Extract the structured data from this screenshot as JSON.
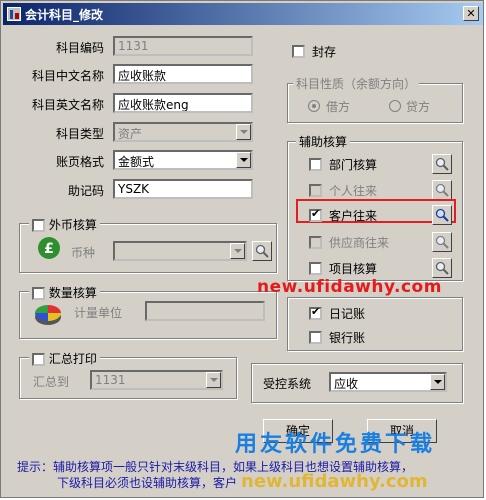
{
  "window": {
    "title": "会计科目_修改"
  },
  "fields": {
    "code_label": "科目编码",
    "code_value": "1131",
    "cn_name_label": "科目中文名称",
    "cn_name_value": "应收账款",
    "en_name_label": "科目英文名称",
    "en_name_value": "应收账款eng",
    "type_label": "科目类型",
    "type_value": "资产",
    "format_label": "账页格式",
    "format_value": "金额式",
    "mnemonic_label": "助记码",
    "mnemonic_value": "YSZK"
  },
  "foreign": {
    "title": "外币核算",
    "currency_label": "币种",
    "currency_value": ""
  },
  "quantity": {
    "title": "数量核算",
    "unit_label": "计量单位",
    "unit_value": ""
  },
  "summary": {
    "title": "汇总打印",
    "to_label": "汇总到",
    "to_value": "1131"
  },
  "seal": {
    "label": "封存",
    "checked": false
  },
  "nature": {
    "title": "科目性质（余额方向）",
    "debit": "借方",
    "credit": "贷方",
    "selected": "debit"
  },
  "aux": {
    "title": "辅助核算",
    "items": [
      {
        "label": "部门核算",
        "checked": false,
        "enabled": true
      },
      {
        "label": "个人往来",
        "checked": false,
        "enabled": false
      },
      {
        "label": "客户往来",
        "checked": true,
        "enabled": true
      },
      {
        "label": "供应商往来",
        "checked": false,
        "enabled": false
      },
      {
        "label": "项目核算",
        "checked": false,
        "enabled": true
      }
    ]
  },
  "ledger": {
    "daily": "日记账",
    "daily_checked": true,
    "bank": "银行账",
    "bank_checked": false
  },
  "control": {
    "label": "受控系统",
    "value": "应收"
  },
  "buttons": {
    "ok": "确定",
    "cancel": "取消"
  },
  "hint": {
    "line1": "提示：辅助核算项一般只针对末级科目，如果上级科目也想设置辅助核算，",
    "line2": "下级科目必须也设辅助核算，客户"
  },
  "watermarks": {
    "url1": "new.ufidawhy.com",
    "brand": "用友软件免费下载",
    "url2": "new.ufidawhy.com"
  },
  "colors": {
    "title_start": "#0a246a",
    "highlight_box": "#e02020",
    "hint_text": "#1a1aa8"
  }
}
